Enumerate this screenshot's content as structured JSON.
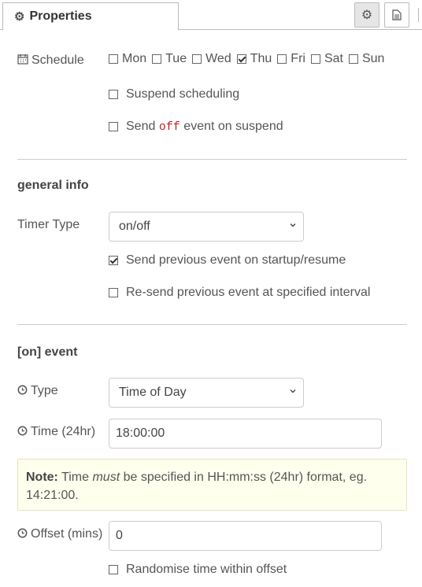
{
  "tab": {
    "title": "Properties",
    "icon": "gear-icon"
  },
  "toolbar": {
    "settings_icon": "gear-icon",
    "doc_icon": "file-icon"
  },
  "schedule": {
    "label": "Schedule",
    "days": [
      {
        "name": "Mon",
        "checked": false
      },
      {
        "name": "Tue",
        "checked": false
      },
      {
        "name": "Wed",
        "checked": false
      },
      {
        "name": "Thu",
        "checked": true
      },
      {
        "name": "Fri",
        "checked": false
      },
      {
        "name": "Sat",
        "checked": false
      },
      {
        "name": "Sun",
        "checked": false
      }
    ],
    "suspend_label": "Suspend scheduling",
    "suspend_checked": false,
    "send_prefix": "Send",
    "send_code": "off",
    "send_suffix": "event on suspend",
    "send_checked": false
  },
  "general": {
    "heading": "general info",
    "timer_type_label": "Timer Type",
    "timer_type_value": "on/off",
    "startup_label": "Send previous event on startup/resume",
    "startup_checked": true,
    "resend_label": "Re-send previous event at specified interval",
    "resend_checked": false
  },
  "on_event": {
    "heading": "[on] event",
    "type_label": "Type",
    "type_value": "Time of Day",
    "time_label": "Time (24hr)",
    "time_value": "18:00:00",
    "note_bold": "Note:",
    "note_pre": "Time",
    "note_em": "must",
    "note_post": "be specified in HH:mm:ss (24hr) format, eg. 14:21:00.",
    "offset_label": "Offset (mins)",
    "offset_value": "0",
    "randomise_label": "Randomise time within offset",
    "randomise_checked": false
  }
}
